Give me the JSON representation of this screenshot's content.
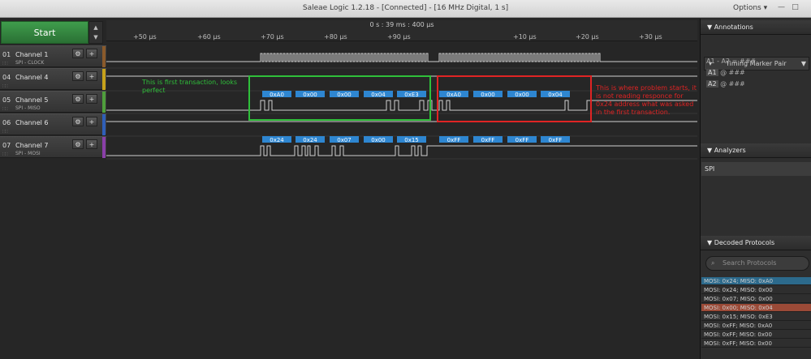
{
  "window": {
    "title": "Saleae Logic 1.2.18 - [Connected] - [16 MHz Digital, 1 s]",
    "options_label": "Options ▾"
  },
  "controls": {
    "start_label": "Start"
  },
  "channels": [
    {
      "num": "01",
      "name": "Channel 1",
      "sub": "SPI - CLOCK",
      "color": "#8a5a2b"
    },
    {
      "num": "04",
      "name": "Channel 4",
      "sub": "",
      "color": "#c7a21b"
    },
    {
      "num": "05",
      "name": "Channel 5",
      "sub": "SPI - MISO",
      "color": "#4f9e3c"
    },
    {
      "num": "06",
      "name": "Channel 6",
      "sub": "",
      "color": "#2f5fb8"
    },
    {
      "num": "07",
      "name": "Channel 7",
      "sub": "SPI - MOSI",
      "color": "#8a3fa8"
    }
  ],
  "ruler": {
    "label": "0 s : 39 ms : 400 µs",
    "ticks": [
      "+50 µs",
      "+60 µs",
      "+70 µs",
      "+80 µs",
      "+90 µs",
      "+10 µs",
      "+20 µs",
      "+30 µs"
    ]
  },
  "decoded": {
    "miso": [
      "0xA0",
      "0x00",
      "0x00",
      "0x04",
      "0xE3",
      "0xA0",
      "0x00",
      "0x00",
      "0x04"
    ],
    "mosi": [
      "0x24",
      "0x24",
      "0x07",
      "0x00",
      "0x15",
      "0xFF",
      "0xFF",
      "0xFF",
      "0xFF"
    ]
  },
  "annotations": {
    "green_text": "This is first transaction, looks perfect",
    "red_text": "This is where problem starts, it is not reading responce for 0x24 address what was asked in the first transaction.",
    "green_color": "#2fbf3a",
    "red_color": "#e02424"
  },
  "right_panel": {
    "annotations_header": "Annotations",
    "timing_marker": "Timing Marker Pair",
    "marker_line1": "A1 - A2 = ###",
    "marker_a1": "A1",
    "marker_a2": "A2",
    "marker_a1_val": "@ ###",
    "marker_a2_val": "@ ###",
    "analyzers_header": "Analyzers",
    "analyzer_item": "SPI",
    "decoded_header": "Decoded Protocols",
    "search_placeholder": "Search Protocols",
    "protocols": [
      {
        "text": "MOSI: 0x24;  MISO: 0xA0",
        "bg": "#2c6a8c"
      },
      {
        "text": "MOSI: 0x24;  MISO: 0x00",
        "bg": "#2e2e2e"
      },
      {
        "text": "MOSI: 0x07;  MISO: 0x00",
        "bg": "#2e2e2e"
      },
      {
        "text": "MOSI: 0x00;  MISO: 0x04",
        "bg": "#9b4a37"
      },
      {
        "text": "MOSI: 0x15;  MISO: 0xE3",
        "bg": "#2e2e2e"
      },
      {
        "text": "MOSI: 0xFF;  MISO: 0xA0",
        "bg": "#2e2e2e"
      },
      {
        "text": "MOSI: 0xFF;  MISO: 0x00",
        "bg": "#2e2e2e"
      },
      {
        "text": "MOSI: 0xFF;  MISO: 0x00",
        "bg": "#2e2e2e"
      }
    ]
  }
}
